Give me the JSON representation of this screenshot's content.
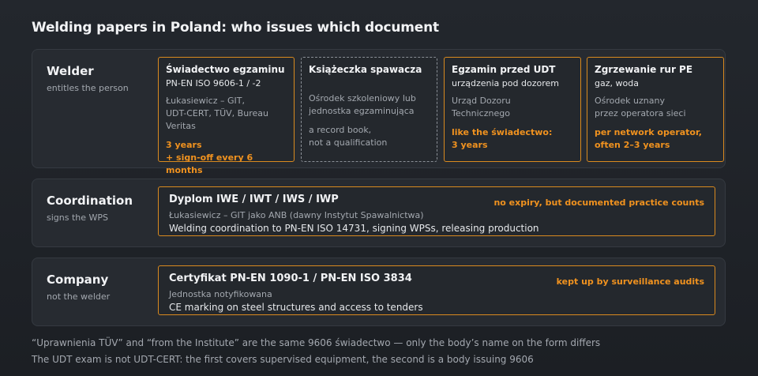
{
  "title": "Welding papers in Poland: who issues which document",
  "sections": {
    "welder": {
      "name": "Welder",
      "sub": "entitles the person",
      "cards": [
        {
          "title": "Świadectwo egzaminu",
          "sub": "PN-EN ISO 9606-1 / -2",
          "issuer": [
            "Łukasiewicz – GIT,",
            "UDT-CERT, TÜV, Bureau Veritas"
          ],
          "validity": [
            "3 years",
            "+ sign-off every 6 months"
          ]
        },
        {
          "title": "Książeczka spawacza",
          "issuer": [
            "Ośrodek szkoleniowy lub",
            "jednostka egzaminująca"
          ],
          "note": [
            "a record book,",
            "not a qualification"
          ]
        },
        {
          "title": "Egzamin przed UDT",
          "sub": "urządzenia pod dozorem",
          "issuer": [
            "Urząd Dozoru",
            "Technicznego"
          ],
          "validity": [
            "like the świadectwo:",
            "3 years"
          ]
        },
        {
          "title": "Zgrzewanie rur PE",
          "sub": "gaz, woda",
          "issuer": [
            "Ośrodek uznany",
            "przez operatora sieci"
          ],
          "validity": [
            "per network operator,",
            "often 2–3 years"
          ]
        }
      ]
    },
    "coordination": {
      "name": "Coordination",
      "sub": "signs the WPS",
      "card": {
        "title": "Dyplom IWE / IWT / IWS / IWP",
        "issuer": "Łukasiewicz – GIT jako ANB (dawny Instytut Spawalnictwa)",
        "desc": "Welding coordination to PN-EN ISO 14731, signing WPSs, releasing production",
        "badge": "no expiry, but documented practice counts"
      }
    },
    "company": {
      "name": "Company",
      "sub": "not the welder",
      "card": {
        "title": "Certyfikat PN-EN 1090-1 / PN-EN ISO 3834",
        "issuer": "Jednostka notyfikowana",
        "desc": "CE marking on steel structures and access to tenders",
        "badge": "kept up by surveillance audits"
      }
    }
  },
  "footnotes": [
    "“Uprawnienia TÜV” and “from the Institute” are the same 9606 świadectwo — only the body’s name on the form differs",
    "The UDT exam is not UDT-CERT: the first covers supervised equipment, the second is a body issuing 9606"
  ],
  "colors": {
    "accent": "#f0921f",
    "card_border": "#d98a1f",
    "dashed_border": "#8a8f96",
    "section_bg": "#272b31",
    "page_bg": "#1f2227"
  }
}
